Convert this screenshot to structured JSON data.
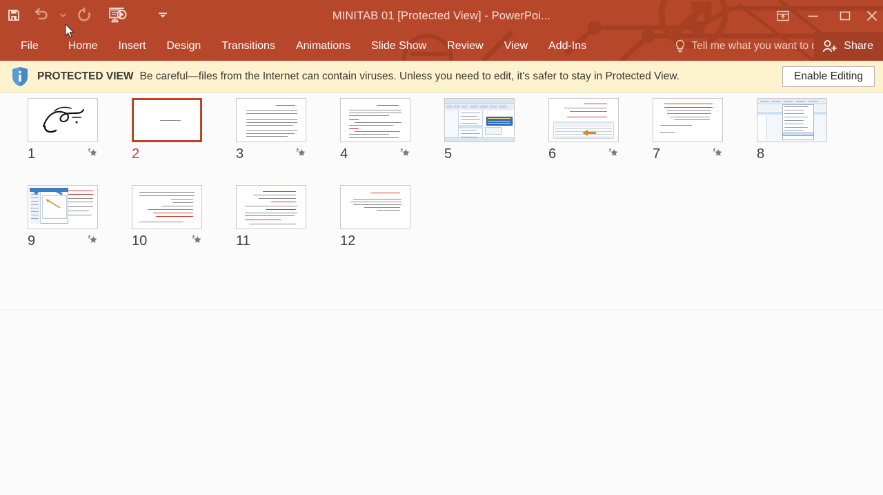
{
  "window": {
    "title": "MINITAB 01 [Protected View] - PowerPoi...",
    "accent_color": "#b7472a",
    "share_bg": "#a23f24",
    "controls": {
      "ribbon_display_options": "ribbon-display-options",
      "minimize": "minimize",
      "maximize": "maximize",
      "close": "close"
    }
  },
  "quick_access": {
    "save": "Save",
    "undo": "Undo",
    "undo_dropdown": "Undo options",
    "redo": "Repeat",
    "start_from_beginning": "Start From Beginning",
    "customize": "Customize Quick Access Toolbar"
  },
  "ribbon": {
    "tabs": [
      {
        "label": "File"
      },
      {
        "label": "Home"
      },
      {
        "label": "Insert"
      },
      {
        "label": "Design"
      },
      {
        "label": "Transitions"
      },
      {
        "label": "Animations"
      },
      {
        "label": "Slide Show"
      },
      {
        "label": "Review"
      },
      {
        "label": "View"
      },
      {
        "label": "Add-Ins"
      }
    ],
    "tell_me": "Tell me what you want to do.",
    "share": "Share"
  },
  "protected_view": {
    "label": "PROTECTED VIEW",
    "message": "Be careful—files from the Internet can contain viruses. Unless you need to edit, it's safer to stay in Protected View.",
    "button": "Enable Editing",
    "bar_color": "#fdf3ce",
    "icon": "info-shield-icon"
  },
  "slide_sorter": {
    "slides": [
      {
        "number": "1",
        "selected": false,
        "animated": true,
        "kind": "calligraphy"
      },
      {
        "number": "2",
        "selected": true,
        "animated": false,
        "kind": "title-line"
      },
      {
        "number": "3",
        "selected": false,
        "animated": true,
        "kind": "text-red-head"
      },
      {
        "number": "4",
        "selected": false,
        "animated": true,
        "kind": "text-bullets"
      },
      {
        "number": "5",
        "selected": false,
        "animated": false,
        "kind": "app-screenshot"
      },
      {
        "number": "6",
        "selected": false,
        "animated": true,
        "kind": "red-text-arrow"
      },
      {
        "number": "7",
        "selected": false,
        "animated": true,
        "kind": "red-heading-text"
      },
      {
        "number": "8",
        "selected": false,
        "animated": false,
        "kind": "menu-screenshot"
      },
      {
        "number": "9",
        "selected": false,
        "animated": true,
        "kind": "explorer-arrow"
      },
      {
        "number": "10",
        "selected": false,
        "animated": true,
        "kind": "text-lines"
      },
      {
        "number": "11",
        "selected": false,
        "animated": false,
        "kind": "text-red-mixed"
      },
      {
        "number": "12",
        "selected": false,
        "animated": false,
        "kind": "text-short"
      }
    ]
  }
}
